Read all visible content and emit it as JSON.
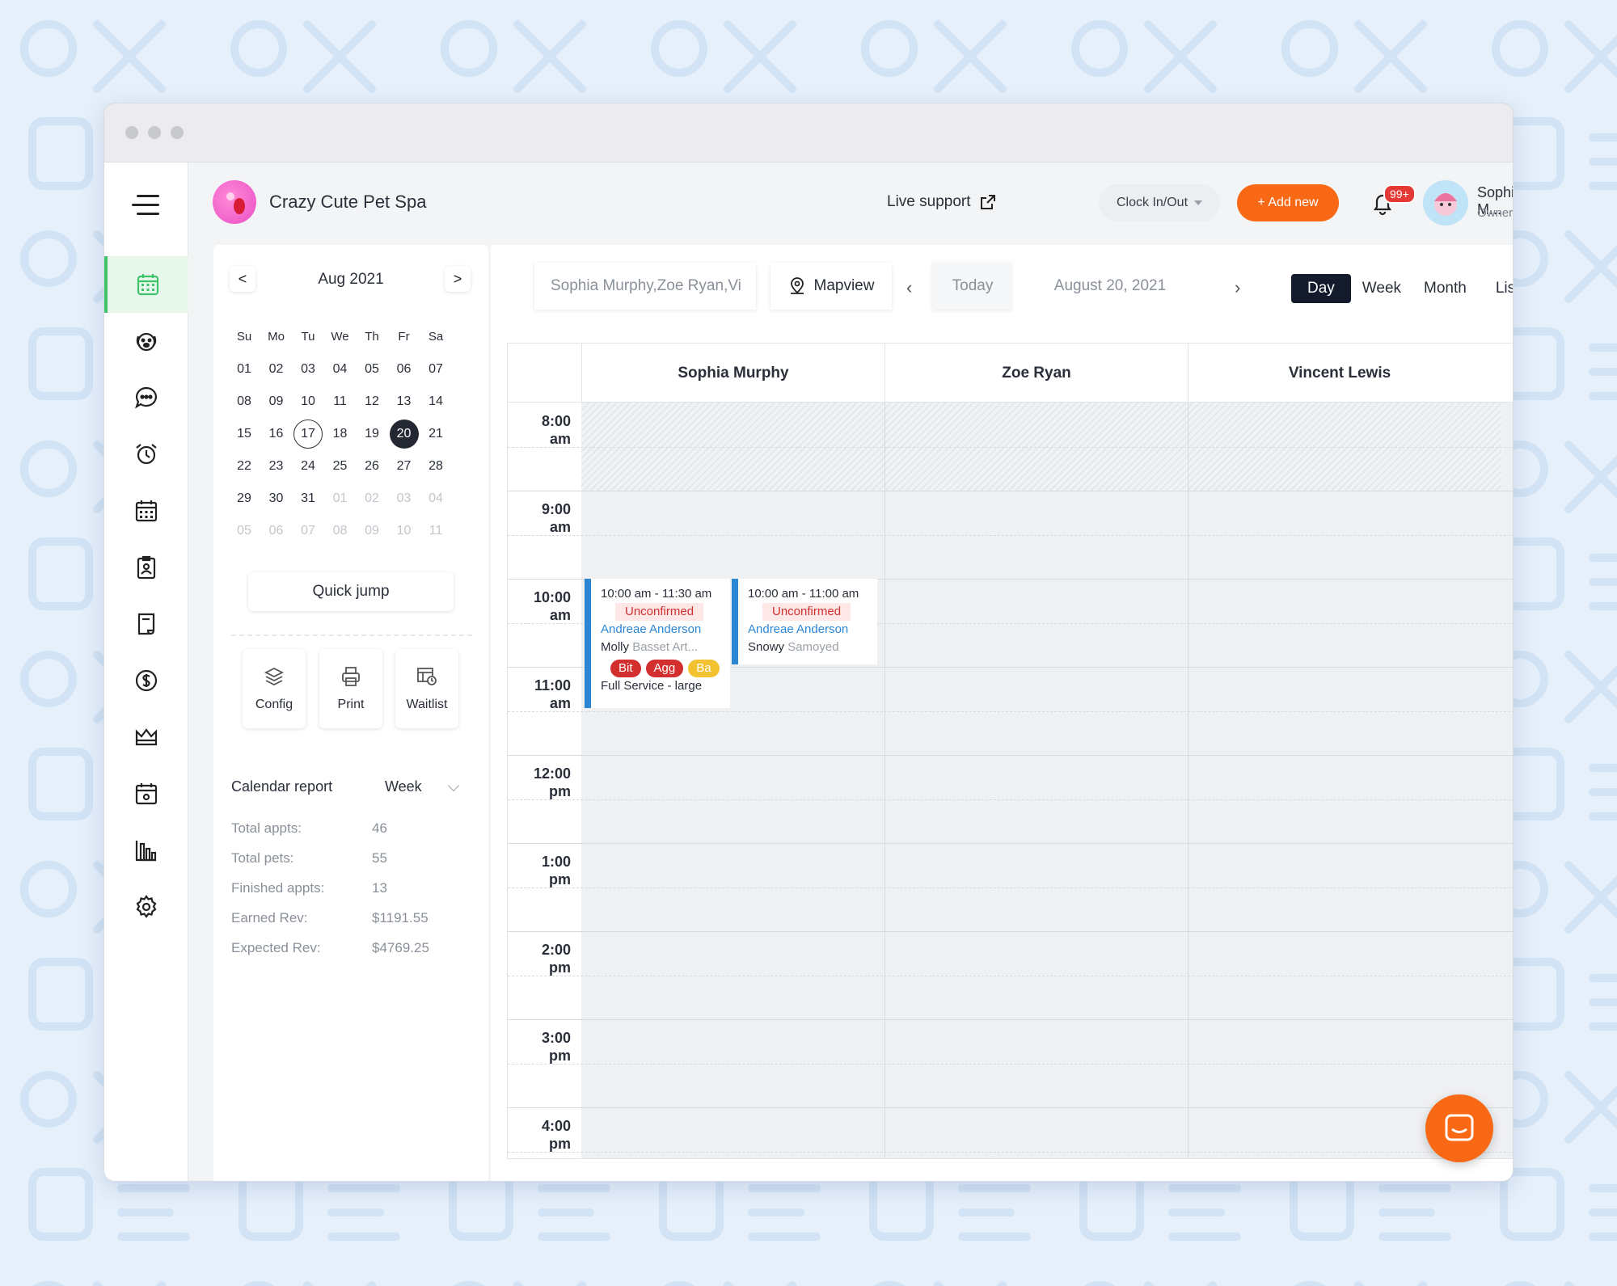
{
  "header": {
    "brand": "Crazy Cute Pet Spa",
    "live_support": "Live support",
    "clock_label": "Clock In/Out",
    "add_new": "+ Add new",
    "notif_badge": "99+",
    "user_name": "Sophia M...",
    "user_role": "Owner"
  },
  "sidebar": {
    "items": [
      "calendar-icon",
      "dog-icon",
      "chat-icon",
      "alarm-icon",
      "schedule-icon",
      "badge-icon",
      "document-icon",
      "dollar-icon",
      "crown-icon",
      "calendar-check-icon",
      "bar-chart-icon",
      "gear-icon"
    ],
    "active_color": "#3fc46b"
  },
  "mini_calendar": {
    "title": "Aug 2021",
    "prev": "<",
    "next": ">",
    "weekdays": [
      "Su",
      "Mo",
      "Tu",
      "We",
      "Th",
      "Fr",
      "Sa"
    ],
    "weeks": [
      [
        "01",
        "02",
        "03",
        "04",
        "05",
        "06",
        "07"
      ],
      [
        "08",
        "09",
        "10",
        "11",
        "12",
        "13",
        "14"
      ],
      [
        "15",
        "16",
        "17",
        "18",
        "19",
        "20",
        "21"
      ],
      [
        "22",
        "23",
        "24",
        "25",
        "26",
        "27",
        "28"
      ],
      [
        "29",
        "30",
        "31",
        "01",
        "02",
        "03",
        "04"
      ],
      [
        "05",
        "06",
        "07",
        "08",
        "09",
        "10",
        "11"
      ]
    ],
    "today": "17",
    "selected": "20",
    "quick_jump": "Quick jump"
  },
  "tools": {
    "config": "Config",
    "print": "Print",
    "waitlist": "Waitlist"
  },
  "report": {
    "title": "Calendar report",
    "period": "Week",
    "stats": [
      {
        "label": "Total appts:",
        "value": "46"
      },
      {
        "label": "Total pets:",
        "value": "55"
      },
      {
        "label": "Finished appts:",
        "value": "13"
      },
      {
        "label": "Earned Rev:",
        "value": "$1191.55"
      },
      {
        "label": "Expected Rev:",
        "value": "$4769.25"
      }
    ]
  },
  "toolbar": {
    "staff_filter": "Sophia Murphy,Zoe Ryan,Vi",
    "mapview": "Mapview",
    "today": "Today",
    "date": "August 20, 2021",
    "views": [
      "Day",
      "Week",
      "Month",
      "List"
    ],
    "active_view": "Day"
  },
  "schedule": {
    "staff": [
      "Sophia Murphy",
      "Zoe Ryan",
      "Vincent Lewis"
    ],
    "times": [
      {
        "hour": "8:00",
        "ampm": "am"
      },
      {
        "hour": "9:00",
        "ampm": "am"
      },
      {
        "hour": "10:00",
        "ampm": "am"
      },
      {
        "hour": "11:00",
        "ampm": "am"
      },
      {
        "hour": "12:00",
        "ampm": "pm"
      },
      {
        "hour": "1:00",
        "ampm": "pm"
      },
      {
        "hour": "2:00",
        "ampm": "pm"
      },
      {
        "hour": "3:00",
        "ampm": "pm"
      },
      {
        "hour": "4:00",
        "ampm": "pm"
      }
    ],
    "appointments": [
      {
        "time": "10:00 am - 11:30 am",
        "status": "Unconfirmed",
        "client": "Andreae Anderson",
        "pet": "Molly",
        "breed": "Basset Art...",
        "tags": [
          {
            "label": "Bit",
            "color": "#d32f2f"
          },
          {
            "label": "Agg",
            "color": "#d32f2f"
          },
          {
            "label": "Ba",
            "color": "#f2c230"
          }
        ],
        "service": "Full Service - large"
      },
      {
        "time": "10:00 am - 11:00 am",
        "status": "Unconfirmed",
        "client": "Andreae Anderson",
        "pet": "Snowy",
        "breed": "Samoyed"
      }
    ]
  },
  "colors": {
    "accent": "#f96915",
    "appt_border": "#2b86d6",
    "selected_day": "#232833"
  }
}
